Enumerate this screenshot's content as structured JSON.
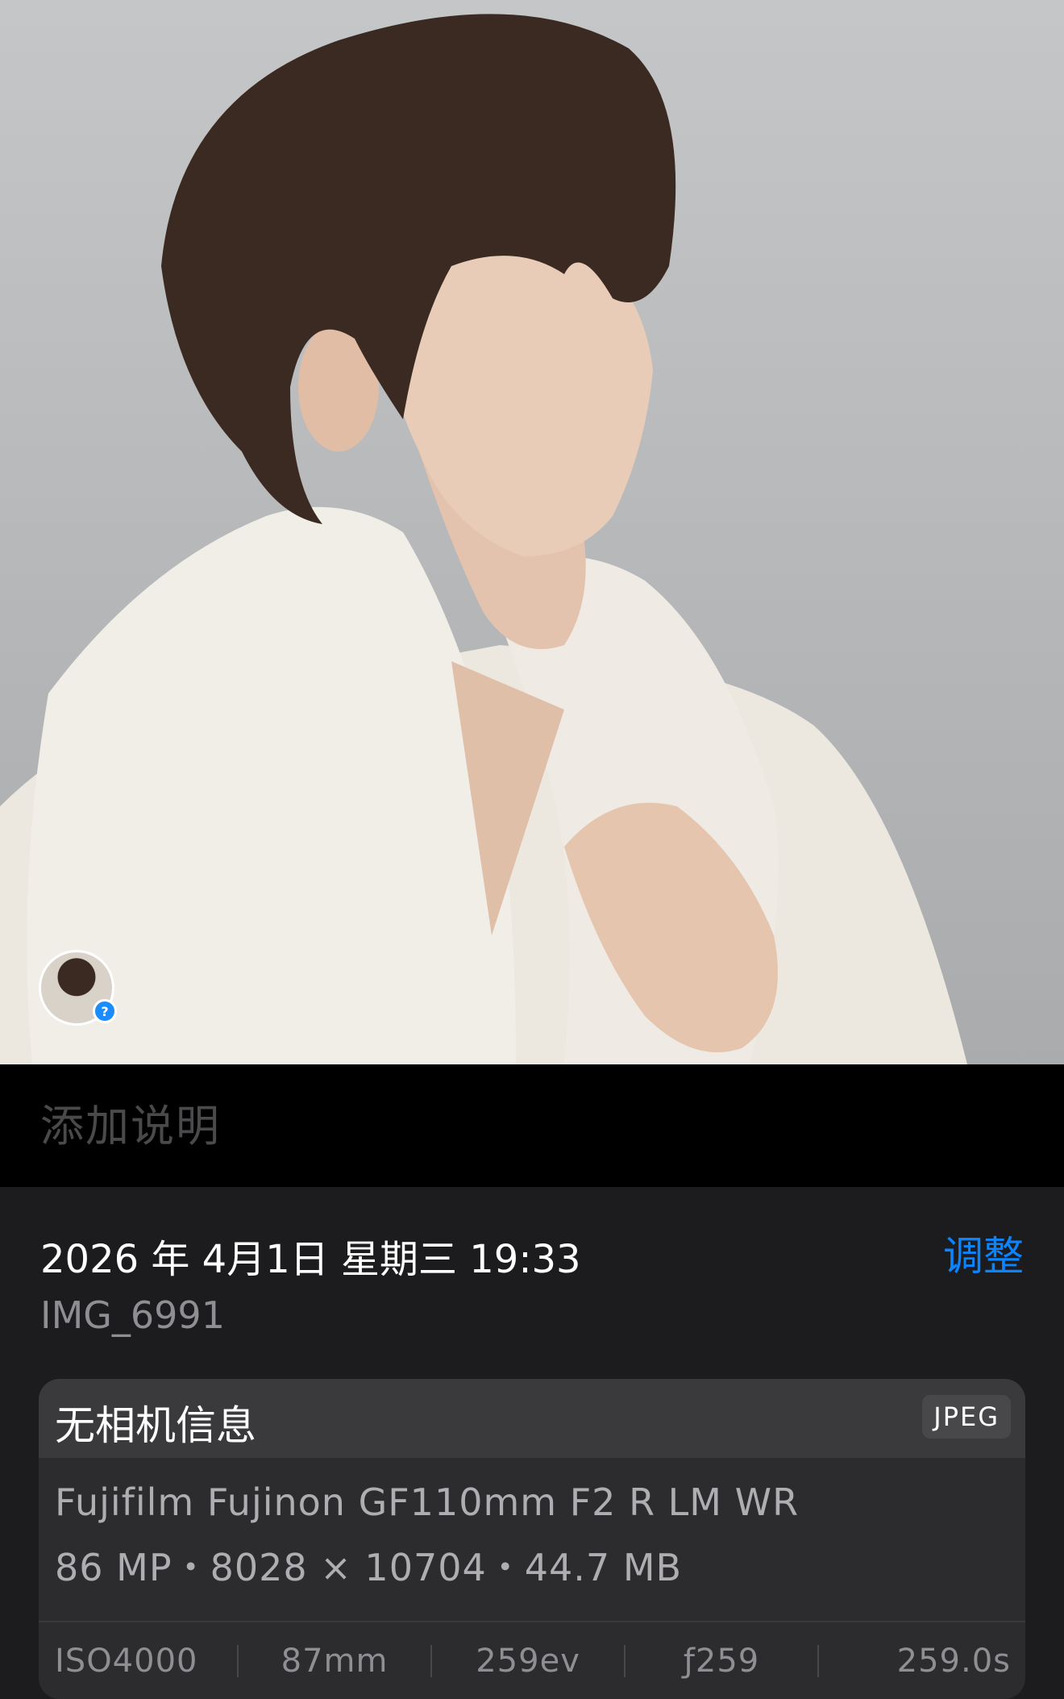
{
  "photo": {
    "alt_icon": "photo-subject"
  },
  "avatar": {
    "badge_symbol": "?",
    "badge_color": "#1a8cff"
  },
  "caption": {
    "placeholder": "添加说明"
  },
  "info": {
    "datetime": "2026 年 4月1日 星期三 19:33",
    "adjust_label": "调整",
    "filename": "IMG_6991",
    "accent_color": "#0a84ff"
  },
  "camera_card": {
    "title": "无相机信息",
    "format": "JPEG",
    "lens": "Fujifilm Fujinon GF110mm F2 R LM WR",
    "specs": "86 MP・8028 × 10704・44.7 MB",
    "exif": {
      "iso": "ISO4000",
      "focal_length": "87mm",
      "exposure_comp": "259ev",
      "aperture": "ƒ259",
      "shutter": "259.0s"
    }
  }
}
